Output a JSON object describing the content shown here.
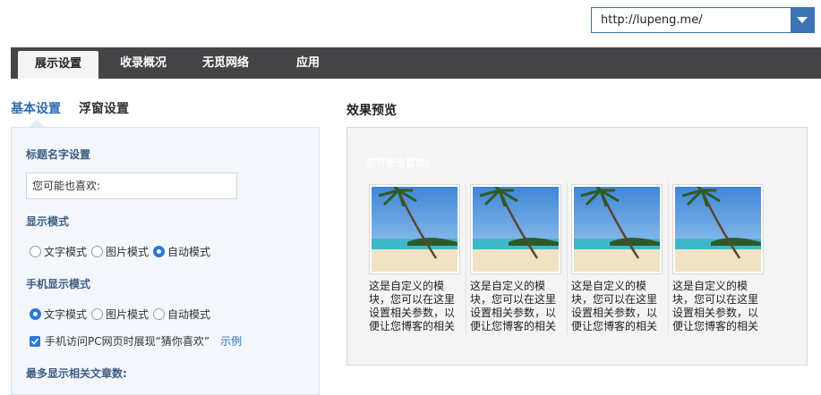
{
  "url_select": {
    "value": "http://lupeng.me/",
    "arrow_icon": "triangle-down-icon"
  },
  "tabs": [
    {
      "label": "展示设置",
      "active": true
    },
    {
      "label": "收录概况",
      "active": false
    },
    {
      "label": "无觅网络",
      "active": false
    },
    {
      "label": "应用",
      "active": false
    }
  ],
  "subtabs": {
    "basic": "基本设置",
    "floating": "浮窗设置"
  },
  "settings": {
    "title_label": "标题名字设置",
    "title_value": "您可能也喜欢:",
    "display_mode_label": "显示模式",
    "display_modes": [
      "文字模式",
      "图片模式",
      "自动模式"
    ],
    "display_mode_selected": "自动模式",
    "mobile_mode_label": "手机显示模式",
    "mobile_modes": [
      "文字模式",
      "图片模式",
      "自动模式"
    ],
    "mobile_mode_selected": "文字模式",
    "mobile_pc_checkbox_label": "手机访问PC网页时展现“猜你喜欢”",
    "mobile_pc_checkbox_checked": true,
    "example_link": "示例",
    "max_articles_label": "最多显示相关文章数:"
  },
  "preview": {
    "title": "效果预览",
    "heading": "您可能也喜欢:",
    "cards": [
      {
        "text": "这是自定义的模块，您可以在这里设置相关参数，以便让您博客的相关"
      },
      {
        "text": "这是自定义的模块，您可以在这里设置相关参数，以便让您博客的相关"
      },
      {
        "text": "这是自定义的模块，您可以在这里设置相关参数，以便让您博客的相关"
      },
      {
        "text": "这是自定义的模块，您可以在这里设置相关参数，以便让您博客的相关"
      }
    ]
  },
  "colors": {
    "accent": "#2f6db3",
    "tabbar": "#444446",
    "radio_on": "#2a78d8"
  }
}
